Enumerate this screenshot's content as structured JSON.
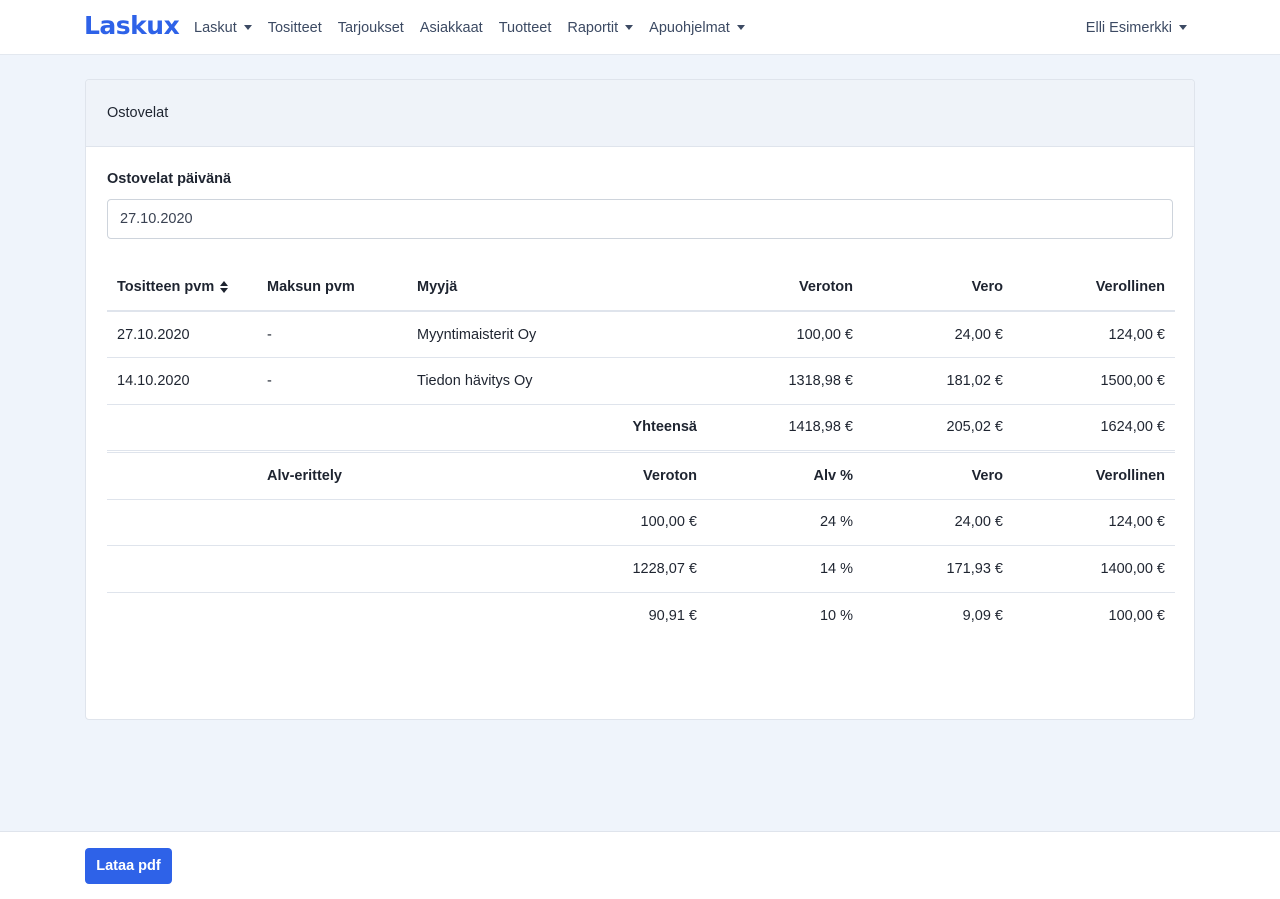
{
  "brand": "Laskux",
  "nav": [
    {
      "label": "Laskut",
      "dropdown": true
    },
    {
      "label": "Tositteet",
      "dropdown": false
    },
    {
      "label": "Tarjoukset",
      "dropdown": false
    },
    {
      "label": "Asiakkaat",
      "dropdown": false
    },
    {
      "label": "Tuotteet",
      "dropdown": false
    },
    {
      "label": "Raportit",
      "dropdown": true
    },
    {
      "label": "Apuohjelmat",
      "dropdown": true
    }
  ],
  "user": {
    "name": "Elli Esimerkki"
  },
  "card": {
    "title": "Ostovelat"
  },
  "date_field": {
    "label": "Ostovelat päivänä",
    "value": "27.10.2020"
  },
  "payables": {
    "headers": {
      "date": "Tositteen pvm",
      "payment_date": "Maksun pvm",
      "seller": "Myyjä",
      "net": "Veroton",
      "tax": "Vero",
      "gross": "Verollinen"
    },
    "rows": [
      {
        "date": "27.10.2020",
        "payment_date": "-",
        "seller": "Myyntimaisterit Oy",
        "net": "100,00 €",
        "tax": "24,00 €",
        "gross": "124,00 €"
      },
      {
        "date": "14.10.2020",
        "payment_date": "-",
        "seller": "Tiedon hävitys Oy",
        "net": "1318,98 €",
        "tax": "181,02 €",
        "gross": "1500,00 €"
      }
    ],
    "total": {
      "label": "Yhteensä",
      "net": "1418,98 €",
      "tax": "205,02 €",
      "gross": "1624,00 €"
    }
  },
  "vat_breakdown": {
    "headers": {
      "title": "Alv-erittely",
      "net": "Veroton",
      "rate": "Alv %",
      "tax": "Vero",
      "gross": "Verollinen"
    },
    "rows": [
      {
        "net": "100,00 €",
        "rate": "24 %",
        "tax": "24,00 €",
        "gross": "124,00 €"
      },
      {
        "net": "1228,07 €",
        "rate": "14 %",
        "tax": "171,93 €",
        "gross": "1400,00 €"
      },
      {
        "net": "90,91 €",
        "rate": "10 %",
        "tax": "9,09 €",
        "gross": "100,00 €"
      }
    ]
  },
  "footer": {
    "download_label": "Lataa pdf"
  },
  "colors": {
    "accent": "#2e62e8",
    "page_bg": "#eff4fb"
  }
}
